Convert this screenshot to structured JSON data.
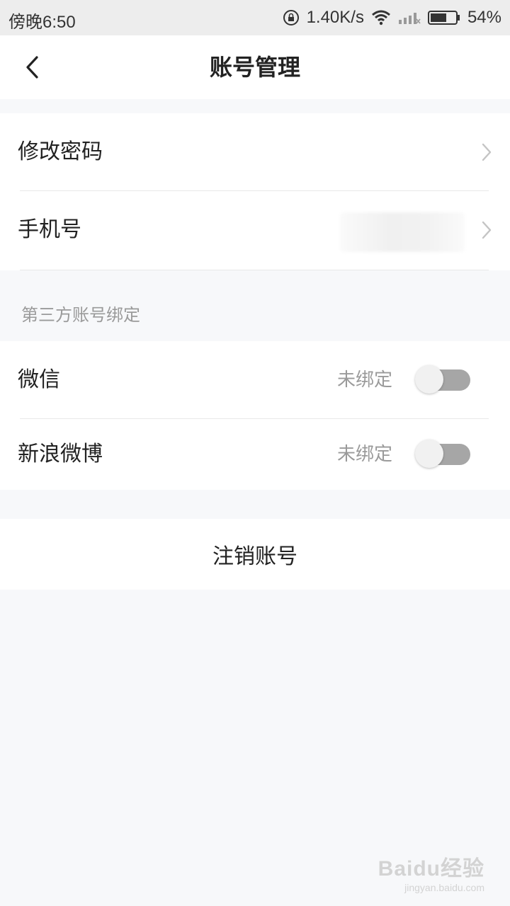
{
  "status_bar": {
    "time": "傍晚6:50",
    "net_speed": "1.40K/s",
    "battery": "54%",
    "icons": [
      "rotation-lock-icon",
      "wifi-icon",
      "signal-icon",
      "battery-icon"
    ]
  },
  "header": {
    "title": "账号管理",
    "back_icon": "chevron-left-icon"
  },
  "account": {
    "items": [
      {
        "label": "修改密码"
      },
      {
        "label": "手机号"
      }
    ]
  },
  "third_party": {
    "header": "第三方账号绑定",
    "items": [
      {
        "label": "微信",
        "status": "未绑定",
        "toggle_on": false
      },
      {
        "label": "新浪微博",
        "status": "未绑定",
        "toggle_on": false
      }
    ]
  },
  "logout": {
    "label": "注销账号"
  },
  "watermark": {
    "main": "Baidu经验",
    "sub": "jingyan.baidu.com"
  },
  "colors": {
    "background": "#f7f8fa",
    "surface": "#ffffff",
    "muted_text": "#9a9a9a",
    "toggle_off": "#a6a6a6"
  }
}
